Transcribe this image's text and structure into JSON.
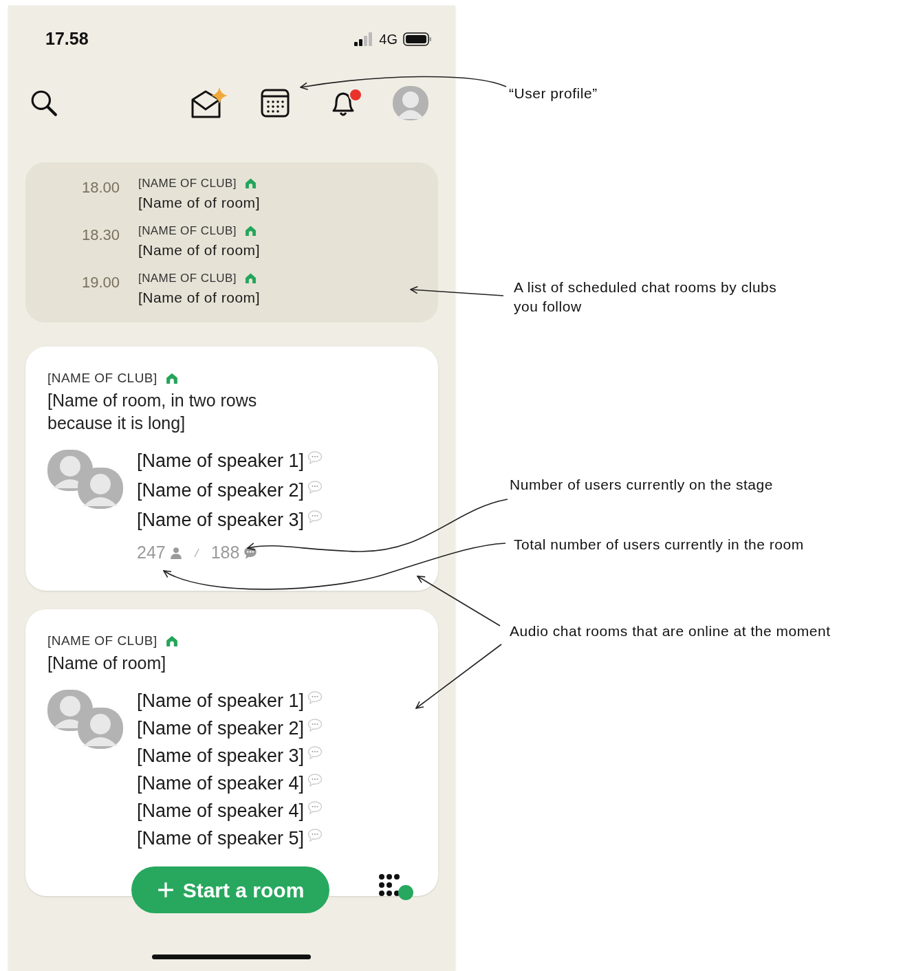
{
  "status_bar": {
    "time": "17.58",
    "network": "4G"
  },
  "header": {
    "bell_badge": true
  },
  "scheduled": [
    {
      "time": "18.00",
      "club": "[NAME OF CLUB]",
      "room": "[Name of of room]"
    },
    {
      "time": "18.30",
      "club": "[NAME OF CLUB]",
      "room": "[Name of of room]"
    },
    {
      "time": "19.00",
      "club": "[NAME OF CLUB]",
      "room": "[Name of of room]"
    }
  ],
  "rooms": [
    {
      "club": "[NAME OF CLUB]",
      "title": "[Name of room, in two rows because it is long]",
      "speakers": [
        "[Name of speaker 1]",
        "[Name of speaker 2]",
        "[Name of speaker 3]"
      ],
      "stats": {
        "listeners": "247",
        "speakers": "188"
      }
    },
    {
      "club": "[NAME OF CLUB]",
      "title": "[Name of room]",
      "speakers": [
        "[Name of speaker 1]",
        "[Name of speaker 2]",
        "[Name of speaker 3]",
        "[Name of speaker 4]",
        "[Name of speaker 4]",
        "[Name of speaker 5]"
      ]
    }
  ],
  "start_button": {
    "label": "Start a room"
  },
  "annotations": [
    {
      "text": "“User profile”"
    },
    {
      "text": "A list of scheduled chat rooms by clubs you follow"
    },
    {
      "text": "Number of users currently on the stage"
    },
    {
      "text": "Total number of users currently in the room"
    },
    {
      "text": "Audio chat rooms that are online at the moment"
    }
  ]
}
